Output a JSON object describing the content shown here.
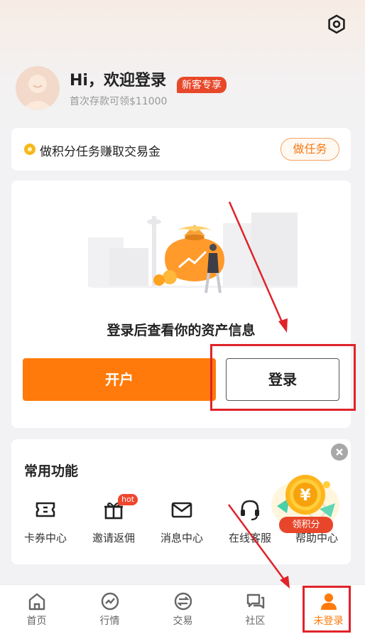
{
  "header": {
    "greeting": "Hi，欢迎登录",
    "badge": "新客专享",
    "subtitle": "首次存款可领$11000",
    "settings_icon": "settings-hexagon-icon"
  },
  "task": {
    "text": "做积分任务赚取交易金",
    "button": "做任务"
  },
  "assets": {
    "message": "登录后查看你的资产信息",
    "open_account": "开户",
    "login": "登录"
  },
  "functions": {
    "title": "常用功能",
    "items": [
      {
        "label": "卡券中心",
        "icon": "ticket-icon"
      },
      {
        "label": "邀请返佣",
        "icon": "gift-icon",
        "badge": "hot"
      },
      {
        "label": "消息中心",
        "icon": "mail-icon"
      },
      {
        "label": "在线客服",
        "icon": "headset-icon"
      },
      {
        "label": "帮助中心",
        "icon": "help-icon"
      }
    ],
    "promo_label": "领积分",
    "promo_coin_symbol": "¥"
  },
  "tabbar": {
    "items": [
      {
        "label": "首页",
        "icon": "home-icon"
      },
      {
        "label": "行情",
        "icon": "chart-icon"
      },
      {
        "label": "交易",
        "icon": "exchange-icon"
      },
      {
        "label": "社区",
        "icon": "community-icon"
      },
      {
        "label": "未登录",
        "icon": "user-icon",
        "active": true
      }
    ]
  },
  "colors": {
    "accent": "#ff7a0a",
    "badge_red": "#e8482a",
    "annotation_red": "#e0232a"
  }
}
